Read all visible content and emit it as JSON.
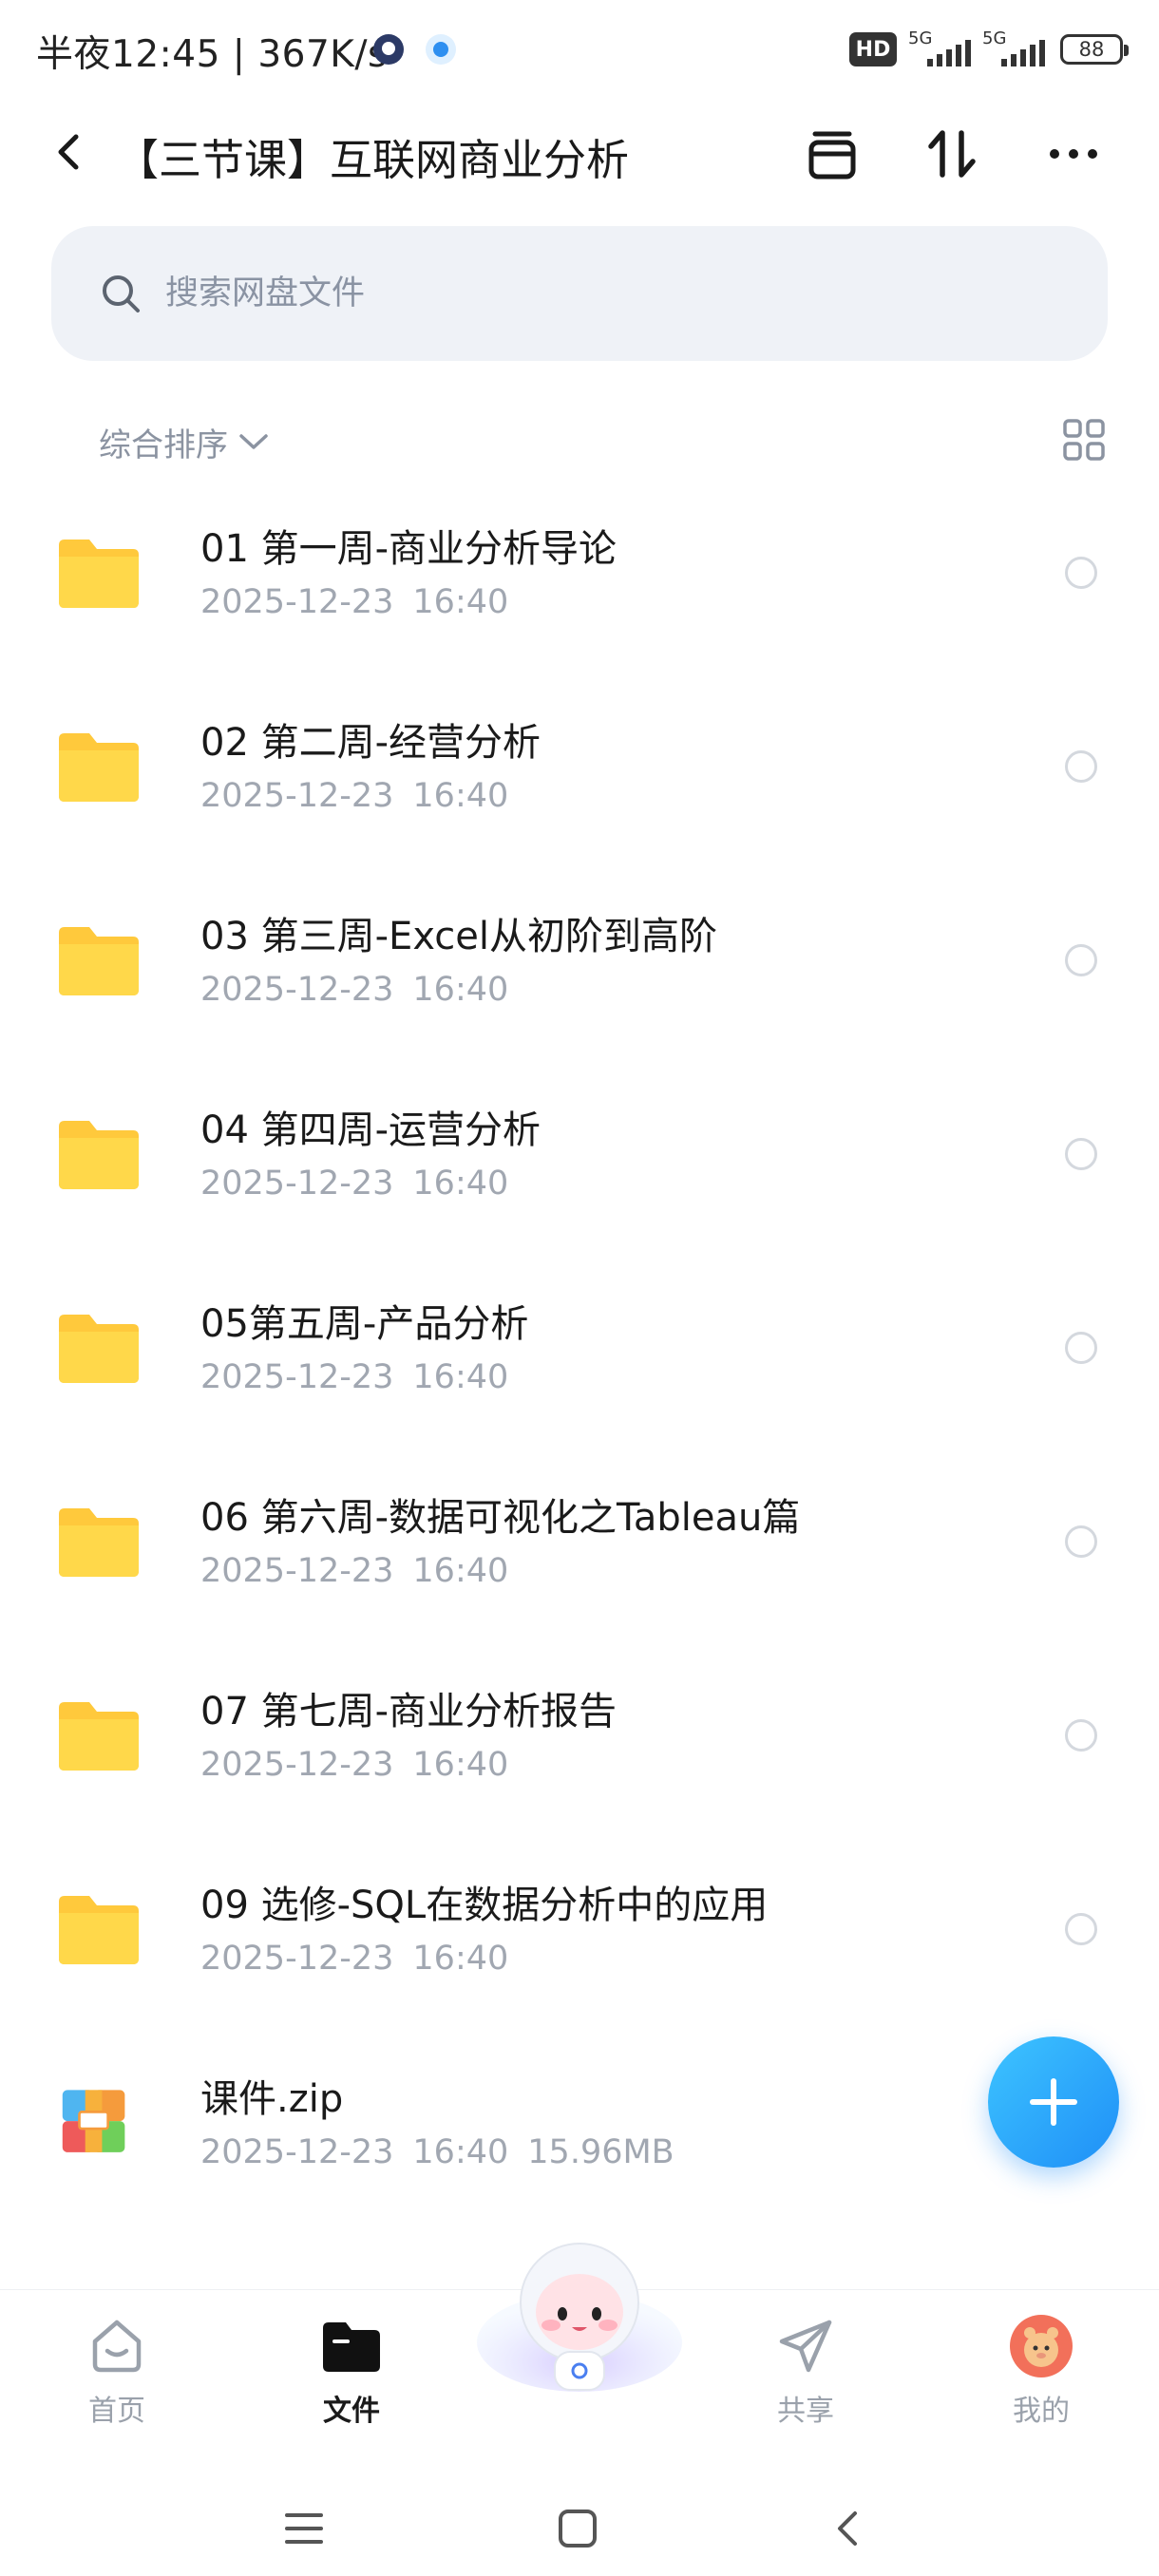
{
  "status_bar": {
    "time": "半夜12:45 | 367K/s",
    "hd_label": "HD",
    "sim1_label": "5G",
    "sim2_label": "5G",
    "battery": "88"
  },
  "header": {
    "title": "【三节课】互联网商业分析"
  },
  "search": {
    "placeholder": "搜索网盘文件"
  },
  "sort": {
    "label": "综合排序"
  },
  "files": [
    {
      "name": "01 第一周-商业分析导论",
      "date": "2025-12-23",
      "time": "16:40",
      "size": "",
      "type": "folder"
    },
    {
      "name": "02 第二周-经营分析",
      "date": "2025-12-23",
      "time": "16:40",
      "size": "",
      "type": "folder"
    },
    {
      "name": "03 第三周-Excel从初阶到高阶",
      "date": "2025-12-23",
      "time": "16:40",
      "size": "",
      "type": "folder"
    },
    {
      "name": "04 第四周-运营分析",
      "date": "2025-12-23",
      "time": "16:40",
      "size": "",
      "type": "folder"
    },
    {
      "name": "05第五周-产品分析",
      "date": "2025-12-23",
      "time": "16:40",
      "size": "",
      "type": "folder"
    },
    {
      "name": "06 第六周-数据可视化之Tableau篇",
      "date": "2025-12-23",
      "time": "16:40",
      "size": "",
      "type": "folder"
    },
    {
      "name": "07 第七周-商业分析报告",
      "date": "2025-12-23",
      "time": "16:40",
      "size": "",
      "type": "folder"
    },
    {
      "name": "09 选修-SQL在数据分析中的应用",
      "date": "2025-12-23",
      "time": "16:40",
      "size": "",
      "type": "folder"
    },
    {
      "name": "课件.zip",
      "date": "2025-12-23",
      "time": "16:40",
      "size": "15.96MB",
      "type": "zip"
    }
  ],
  "bottom_nav": {
    "home": "首页",
    "files": "文件",
    "share": "共享",
    "mine": "我的"
  },
  "colors": {
    "folder": "#ffd23f",
    "accent": "#1f8ff7",
    "muted_text": "#a1a7b1"
  }
}
